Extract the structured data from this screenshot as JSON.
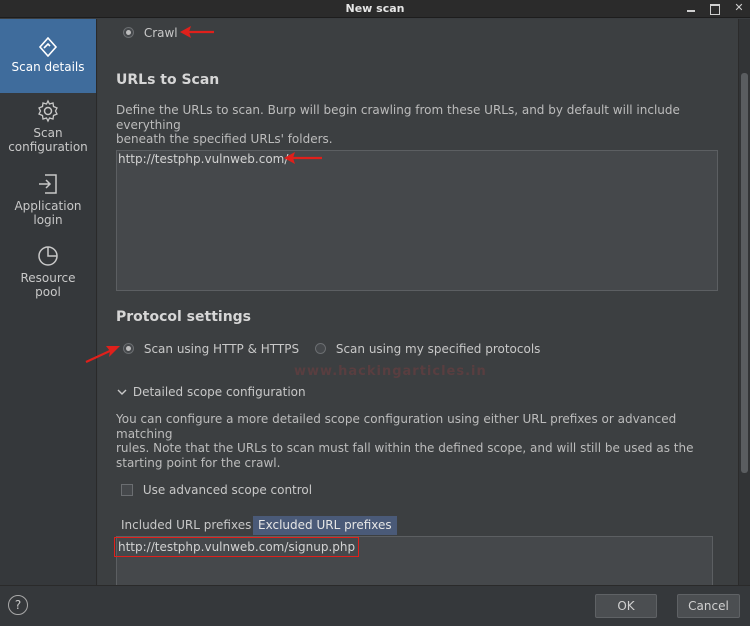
{
  "window": {
    "title": "New scan"
  },
  "sidebar": {
    "items": [
      {
        "label": "Scan details",
        "icon": "scan-details-icon",
        "active": true
      },
      {
        "label": "Scan configuration",
        "icon": "gear-icon",
        "active": false
      },
      {
        "label": "Application login",
        "icon": "login-icon",
        "active": false
      },
      {
        "label": "Resource pool",
        "icon": "pie-icon",
        "active": false
      }
    ]
  },
  "scan_type": {
    "label": "Crawl",
    "selected": true
  },
  "urls": {
    "heading": "URLs to Scan",
    "description_line1": "Define the URLs to scan. Burp will begin crawling from these URLs, and by default will include everything",
    "description_line2": "beneath the specified URLs' folders.",
    "value": "http://testphp.vulnweb.com/"
  },
  "protocol": {
    "heading": "Protocol settings",
    "option_http_https": "Scan using HTTP & HTTPS",
    "option_specified": "Scan using my specified protocols",
    "selected": "option_http_https"
  },
  "scope": {
    "toggle_label": "Detailed scope configuration",
    "description_line1": "You can configure a more detailed scope configuration using either URL prefixes or advanced matching",
    "description_line2": "rules. Note that the URLs to scan must fall within the defined scope, and will still be used as the",
    "description_line3": "starting point for the crawl.",
    "advanced_label": "Use advanced scope control",
    "advanced_checked": false,
    "tab_included": "Included URL prefixes",
    "tab_excluded": "Excluded URL prefixes",
    "selected_tab": "tab_excluded",
    "excluded_value": "http://testphp.vulnweb.com/signup.php"
  },
  "footer": {
    "help": "?",
    "ok": "OK",
    "cancel": "Cancel"
  },
  "colors": {
    "accent_active": "#3f6c9c",
    "annotation_red": "#e0201b"
  }
}
